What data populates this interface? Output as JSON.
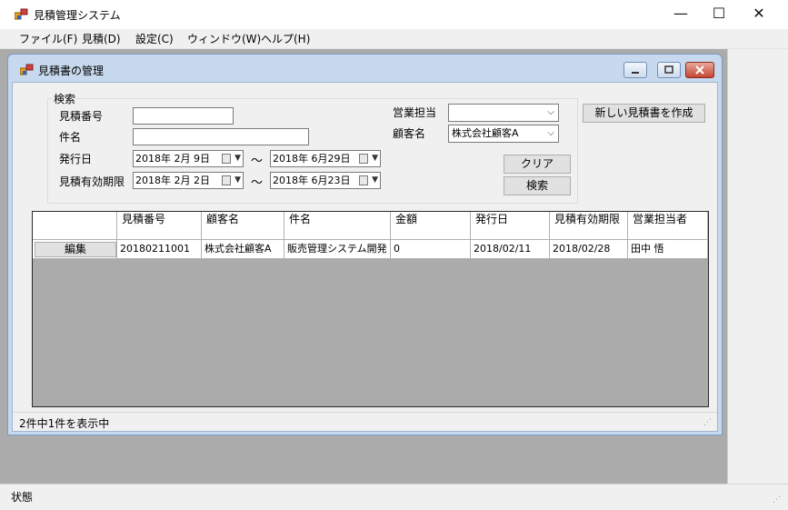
{
  "app": {
    "title": "見積管理システム"
  },
  "window_controls": {
    "minimize": "—",
    "maximize": "☐",
    "close": "✕"
  },
  "menu": [
    {
      "label": "ファイル(F)"
    },
    {
      "label": "見積(D)"
    },
    {
      "label": "設定(C)"
    },
    {
      "label": "ウィンドウ(W)"
    },
    {
      "label": "ヘルプ(H)"
    }
  ],
  "child": {
    "title": "見積書の管理"
  },
  "search": {
    "legend": "検索",
    "estimate_no_label": "見積番号",
    "estimate_no_value": "",
    "subject_label": "件名",
    "subject_value": "",
    "issue_date_label": "発行日",
    "issue_date_from": "2018年  2月  9日",
    "issue_date_to": "2018年  6月29日",
    "expiry_label": "見積有効期限",
    "expiry_from": "2018年  2月  2日",
    "expiry_to": "2018年  6月23日",
    "range_sep": "～",
    "sales_label": "営業担当",
    "sales_value": "",
    "customer_label": "顧客名",
    "customer_value": "株式会社顧客A",
    "clear_button": "クリア",
    "search_button": "検索",
    "new_button": "新しい見積書を作成"
  },
  "grid": {
    "columns": [
      "",
      "見積番号",
      "顧客名",
      "件名",
      "金額",
      "発行日",
      "見積有効期限",
      "営業担当者"
    ],
    "rows": [
      {
        "action": "編集",
        "estimate_no": "20180211001",
        "customer": "株式会社顧客A",
        "subject": "販売管理システム開発",
        "amount": "0",
        "issue_date": "2018/02/11",
        "expiry": "2018/02/28",
        "sales": "田中  悟"
      }
    ]
  },
  "child_status": "2件中1件を表示中",
  "main_status": "状態"
}
